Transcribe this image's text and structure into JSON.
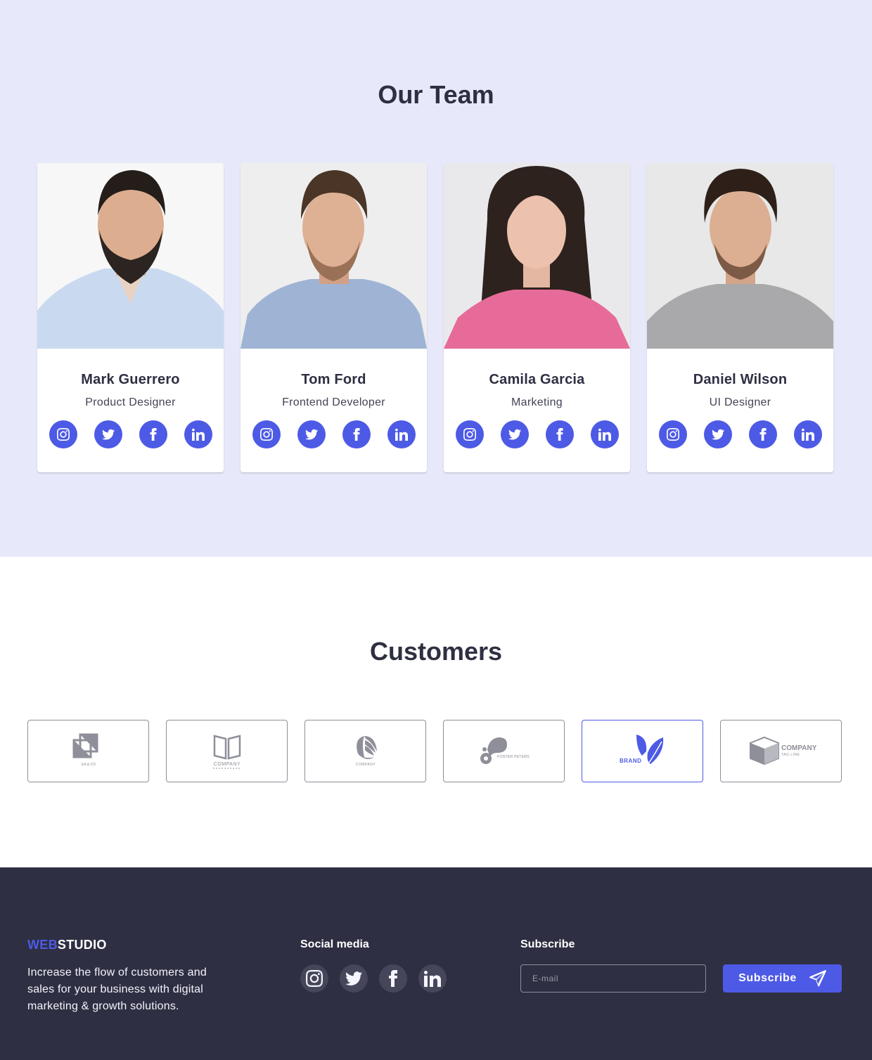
{
  "team": {
    "title": "Our Team",
    "members": [
      {
        "name": "Mark Guerrero",
        "role": "Product Designer"
      },
      {
        "name": "Tom Ford",
        "role": "Frontend Developer"
      },
      {
        "name": "Camila Garcia",
        "role": "Marketing"
      },
      {
        "name": "Daniel Wilson",
        "role": "UI Designer"
      }
    ],
    "social_icons": [
      "instagram-icon",
      "twitter-icon",
      "facebook-icon",
      "linkedin-icon"
    ]
  },
  "customers": {
    "title": "Customers",
    "logos": [
      {
        "icon": "square-logo",
        "caption": "EA & CO"
      },
      {
        "icon": "book-logo",
        "caption": "COMPANY"
      },
      {
        "icon": "shell-logo",
        "caption": "COMPANY"
      },
      {
        "icon": "drop-logo",
        "caption": "FOSTER PETERS"
      },
      {
        "icon": "leaf-logo",
        "caption": "BRAND"
      },
      {
        "icon": "cube-logo",
        "caption": "COMPANY",
        "tagline": "TAG LINE"
      }
    ]
  },
  "footer": {
    "brand_web": "WEB",
    "brand_studio": "STUDIO",
    "about": "Increase the flow of customers and sales for your business with digital marketing & growth solutions.",
    "social_title": "Social media",
    "subscribe_title": "Subscribe",
    "email_placeholder": "E-mail",
    "subscribe_button": "Subscribe"
  },
  "colors": {
    "accent": "#4d5ae5",
    "team_bg": "#e7e8fa",
    "footer_bg": "#2e2f42",
    "text_dark": "#2e2f42",
    "logo_grey": "#8e8f99"
  }
}
